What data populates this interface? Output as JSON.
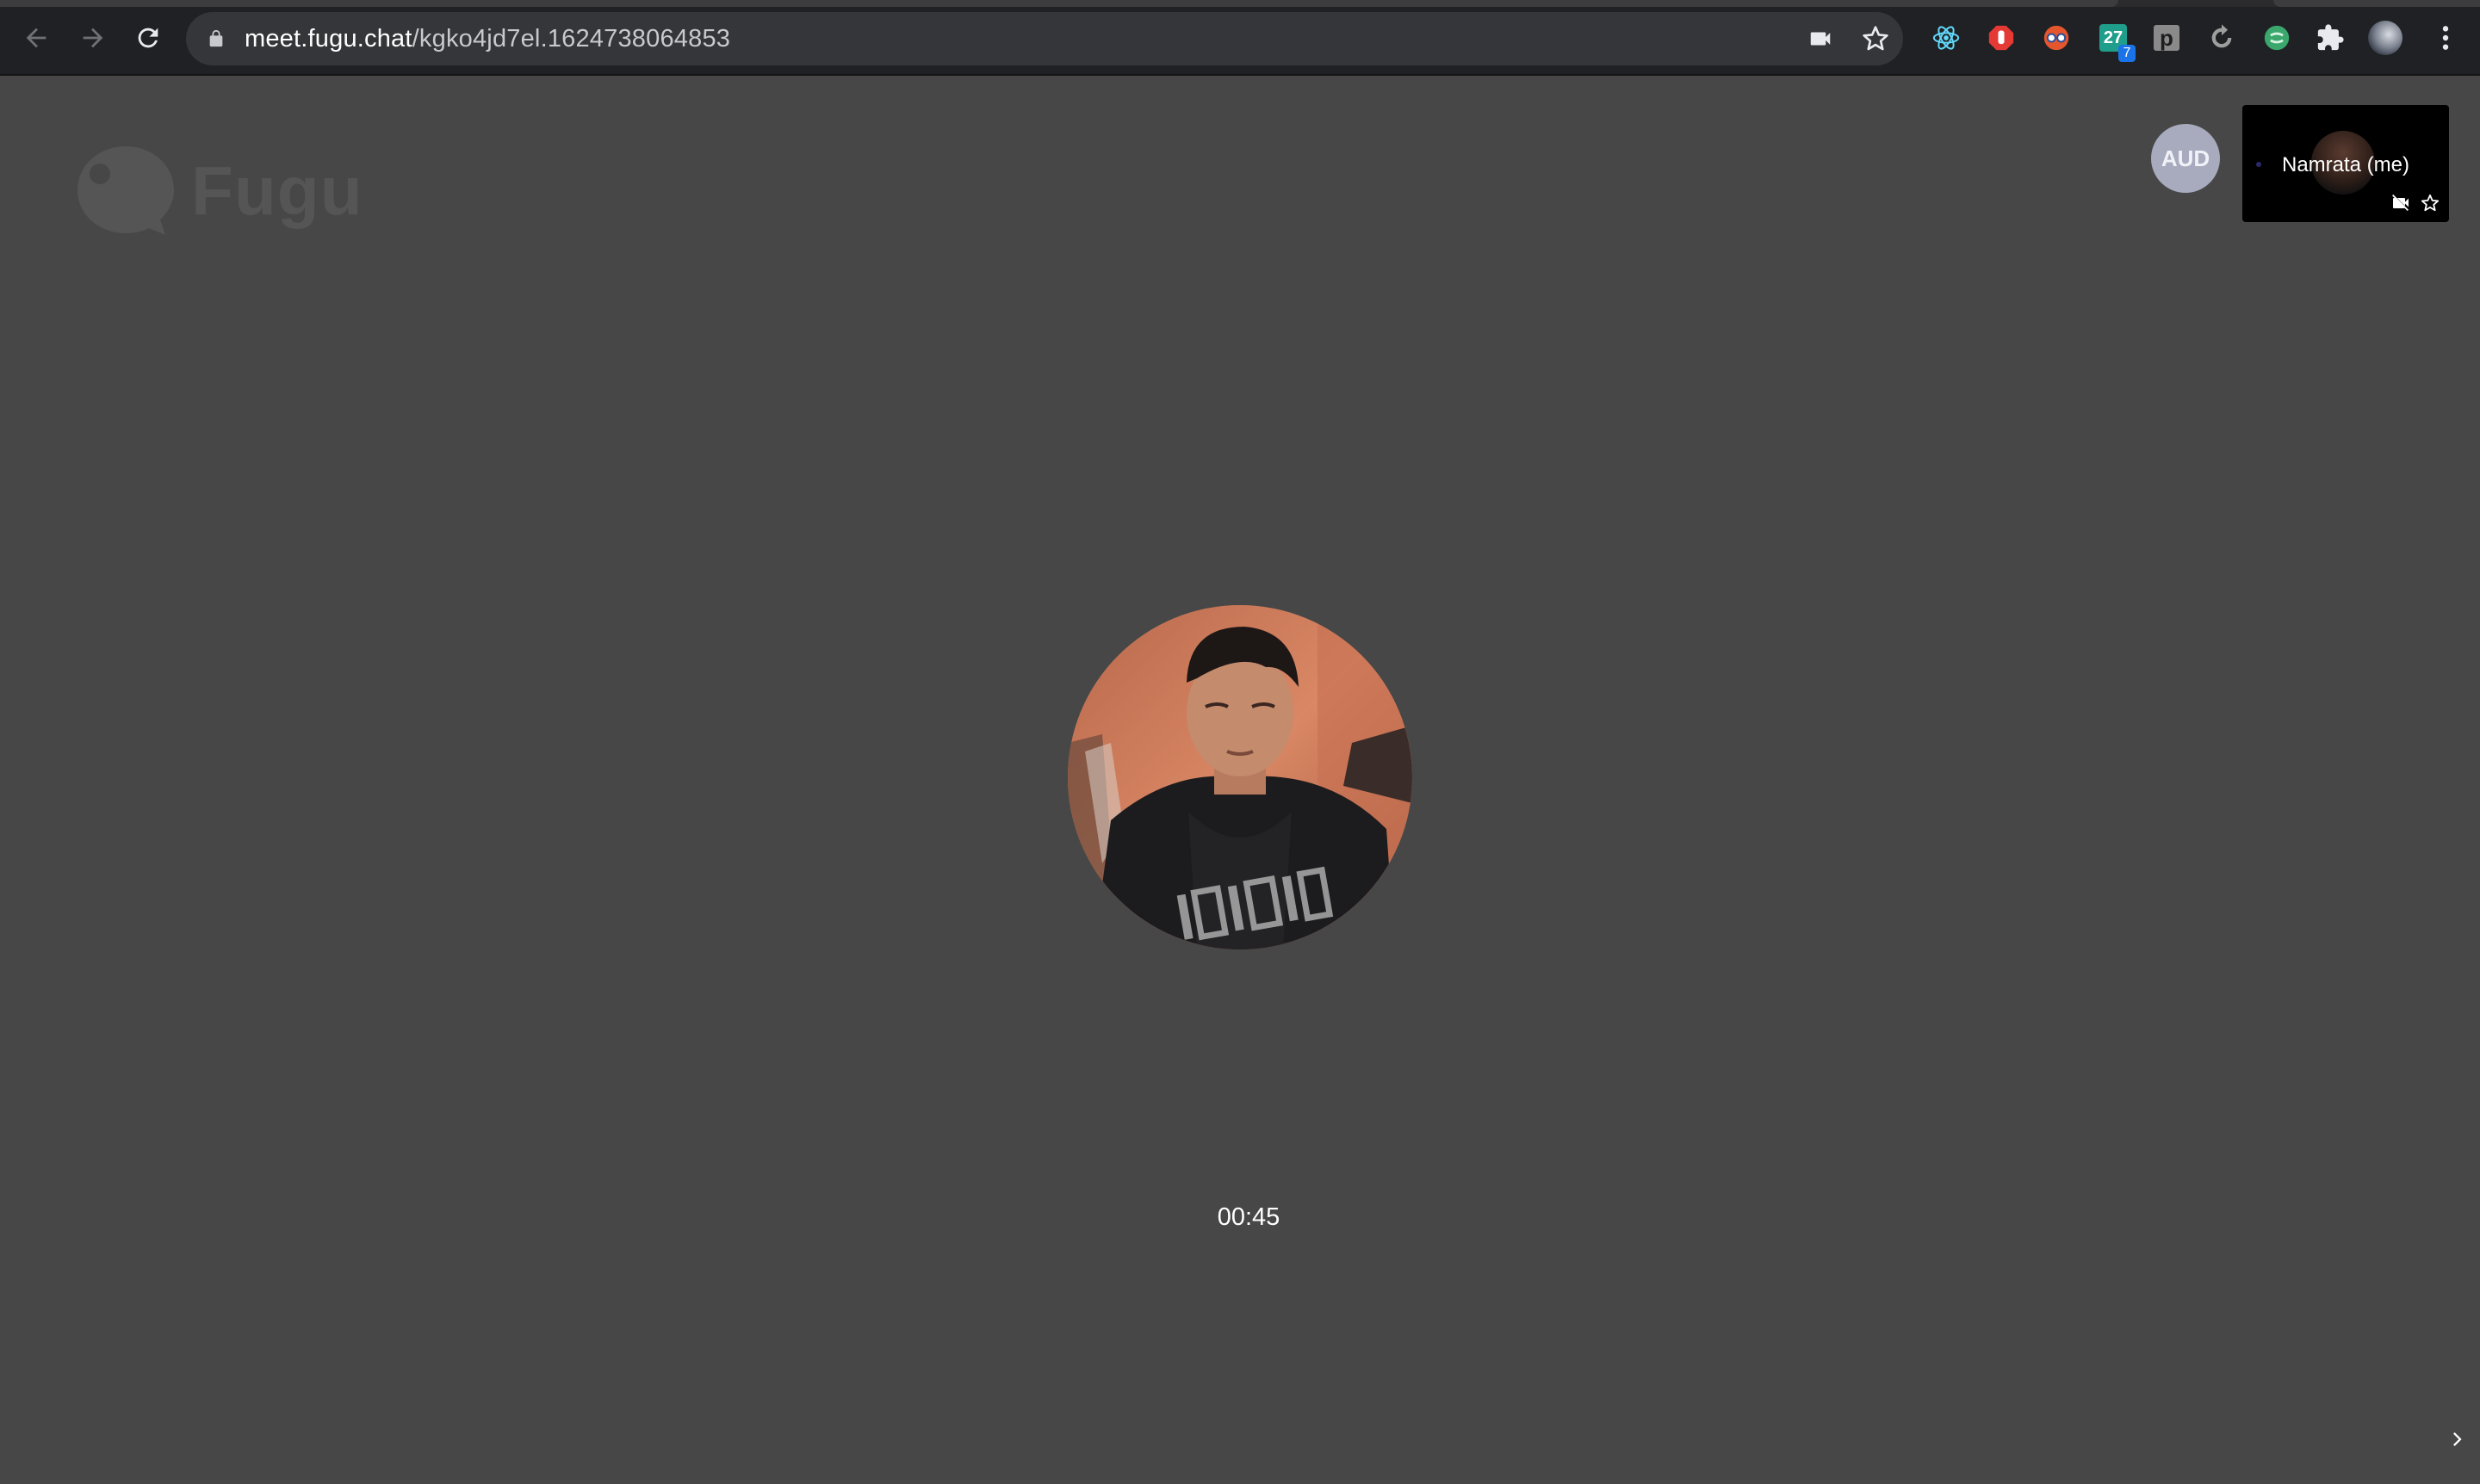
{
  "browser": {
    "url_host": "meet.fugu.chat",
    "url_path": "/kgko4jd7el.1624738064853",
    "extensions": [
      {
        "name": "react-devtools-icon"
      },
      {
        "name": "stop-hand-icon"
      },
      {
        "name": "glasses-extension-icon"
      },
      {
        "name": "calendar-extension-icon",
        "label": "27",
        "badge": "7"
      },
      {
        "name": "p-extension-icon",
        "label": "p"
      },
      {
        "name": "refresh-extension-icon"
      },
      {
        "name": "green-circle-extension-icon"
      }
    ]
  },
  "app": {
    "logo_text": "Fugu",
    "participant_initials": "AUD",
    "self_tile_name": "Namrata (me)",
    "call_timer": "00:45"
  },
  "colors": {
    "page_background": "#474747",
    "toolbar_background": "#202124",
    "omnibox_background": "#35363a",
    "logo_color": "#555555",
    "participant_badge": "#a7abbd"
  }
}
